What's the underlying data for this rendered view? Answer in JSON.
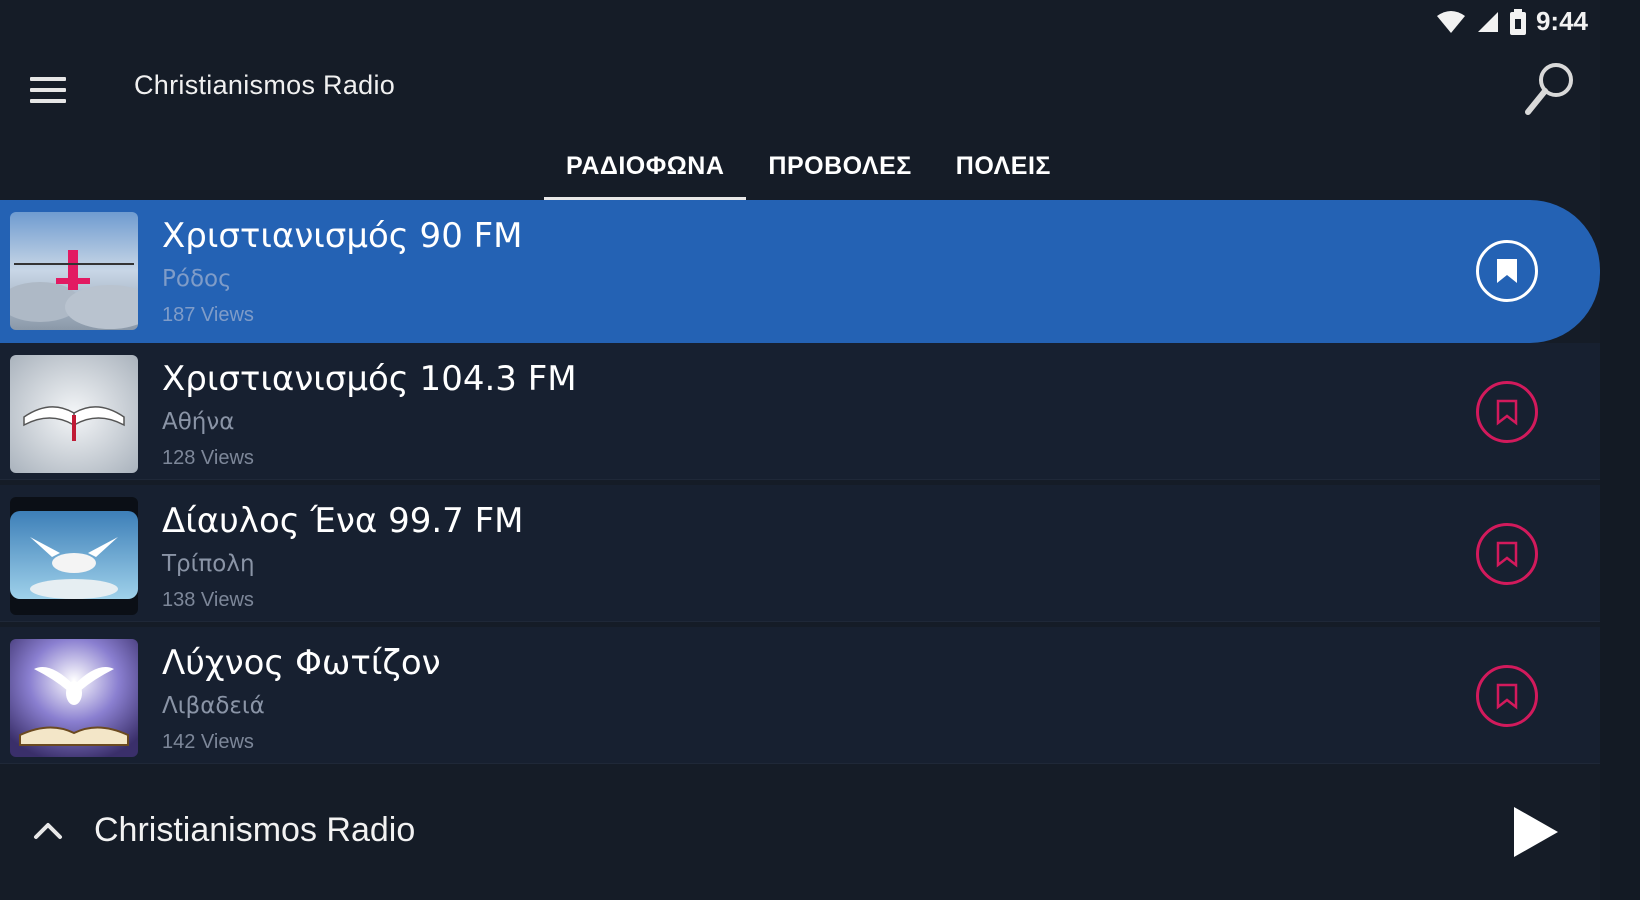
{
  "status_bar": {
    "time": "9:44",
    "icons": [
      "wifi-icon",
      "signal-icon",
      "battery-icon"
    ]
  },
  "app_bar": {
    "title": "Christianismos Radio",
    "menu_icon": "hamburger-menu-icon",
    "search_icon": "search-icon"
  },
  "tabs": [
    {
      "label": "ΡΑΔΙΟΦΩΝΑ",
      "active": true
    },
    {
      "label": "ΠΡΟΒΟΛΕΣ",
      "active": false
    },
    {
      "label": "ΠΟΛΕΙΣ",
      "active": false
    }
  ],
  "stations": [
    {
      "name": "Χριστιανισμός 90 FM",
      "city": "Ρόδος",
      "views": "187 Views",
      "selected": true
    },
    {
      "name": "Χριστιανισμός 104.3 FM",
      "city": "Αθήνα",
      "views": "128 Views",
      "selected": false
    },
    {
      "name": "Δίαυλος Ένα 99.7 FM",
      "city": "Τρίπολη",
      "views": "138 Views",
      "selected": false
    },
    {
      "name": "Λύχνος Φωτίζον",
      "city": "Λιβαδειά",
      "views": "142 Views",
      "selected": false
    }
  ],
  "player": {
    "title": "Christianismos Radio",
    "expand_icon": "chevron-up-icon",
    "play_icon": "play-icon"
  },
  "colors": {
    "background": "#151c27",
    "selected_row": "#2462b4",
    "accent": "#d21a5c"
  }
}
